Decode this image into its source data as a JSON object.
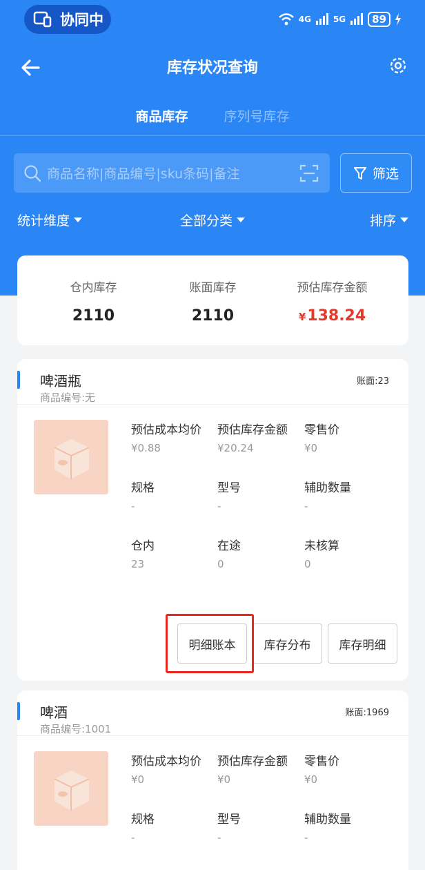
{
  "status_bar": {
    "sync_label": "协同中",
    "network_1": "4G",
    "network_2": "5G",
    "battery": "89"
  },
  "nav": {
    "title": "库存状况查询"
  },
  "tabs": [
    {
      "label": "商品库存",
      "active": true
    },
    {
      "label": "序列号库存",
      "active": false
    }
  ],
  "search": {
    "placeholder": "商品名称|商品编号|sku条码|备注"
  },
  "filter": {
    "label": "筛选"
  },
  "dimensions": {
    "stat": "统计维度",
    "category": "全部分类",
    "sort": "排序"
  },
  "summary": {
    "warehouse_label": "仓内库存",
    "warehouse_value": "2110",
    "book_label": "账面库存",
    "book_value": "2110",
    "amount_label": "预估库存金额",
    "amount_currency": "¥",
    "amount_value": "138.24"
  },
  "field_labels": {
    "avg_cost": "预估成本均价",
    "amount": "预估库存金额",
    "retail": "零售价",
    "spec": "规格",
    "model": "型号",
    "aux_qty": "辅助数量",
    "in_wh": "仓内",
    "in_transit": "在途",
    "unsettled": "未核算"
  },
  "products": [
    {
      "name": "啤酒瓶",
      "code": "商品编号:无",
      "book": "账面:23",
      "avg_cost": "¥0.88",
      "amount": "¥20.24",
      "retail": "¥0",
      "spec": "-",
      "model": "-",
      "aux_qty": "-",
      "in_wh": "23",
      "in_transit": "0",
      "unsettled": "0",
      "buttons": [
        "明细账本",
        "库存分布",
        "库存明细"
      ]
    },
    {
      "name": "啤酒",
      "code": "商品编号:1001",
      "book": "账面:1969",
      "avg_cost": "¥0",
      "amount": "¥0",
      "retail": "¥0",
      "spec": "-",
      "model": "-",
      "aux_qty": "-"
    }
  ],
  "colors": {
    "primary": "#2a86f5",
    "accent_red": "#e23b2e",
    "highlight": "#e8271f"
  }
}
